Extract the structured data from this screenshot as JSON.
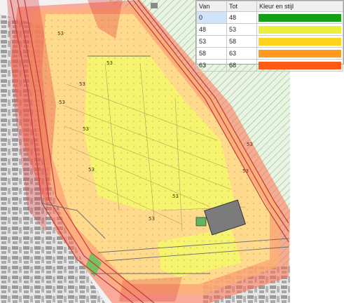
{
  "legend": {
    "headers": {
      "from": "Van",
      "to": "Tot",
      "style": "Kleur en stijl"
    },
    "rows": [
      {
        "from": "0",
        "to": "48",
        "color": "#14a014"
      },
      {
        "from": "48",
        "to": "53",
        "color": "#eaf03a"
      },
      {
        "from": "53",
        "to": "58",
        "color": "#ffd21e"
      },
      {
        "from": "58",
        "to": "63",
        "color": "#ff9a1e"
      },
      {
        "from": "63",
        "to": "68",
        "color": "#ff5a14"
      }
    ]
  },
  "map": {
    "contour_labels": [
      "53",
      "53",
      "53",
      "53",
      "53",
      "53",
      "53",
      "53",
      "53",
      "53"
    ]
  }
}
